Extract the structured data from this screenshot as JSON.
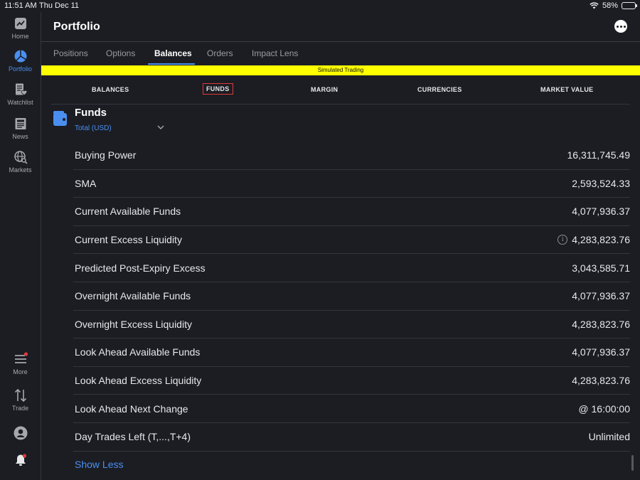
{
  "status_bar": {
    "time": "11:51 AM",
    "date": "Thu Dec 11",
    "battery": "58%"
  },
  "rail": {
    "home": "Home",
    "portfolio": "Portfolio",
    "watchlist": "Watchlist",
    "news": "News",
    "markets": "Markets",
    "more": "More",
    "trade": "Trade"
  },
  "header": {
    "title": "Portfolio"
  },
  "tabs": [
    "Positions",
    "Options",
    "Balances",
    "Orders",
    "Impact Lens"
  ],
  "banner": "Simulated Trading",
  "subtabs": [
    "BALANCES",
    "FUNDS",
    "MARGIN",
    "CURRENCIES",
    "MARKET VALUE"
  ],
  "funds": {
    "title": "Funds",
    "selector": "Total (USD)"
  },
  "rows": [
    {
      "label": "Buying Power",
      "value": "16,311,745.49"
    },
    {
      "label": "SMA",
      "value": "2,593,524.33"
    },
    {
      "label": "Current Available Funds",
      "value": "4,077,936.37"
    },
    {
      "label": "Current Excess Liquidity",
      "value": "4,283,823.76"
    },
    {
      "label": "Predicted Post-Expiry Excess",
      "value": "3,043,585.71"
    },
    {
      "label": "Overnight Available Funds",
      "value": "4,077,936.37"
    },
    {
      "label": "Overnight Excess Liquidity",
      "value": "4,283,823.76"
    },
    {
      "label": "Look Ahead Available Funds",
      "value": "4,077,936.37"
    },
    {
      "label": "Look Ahead Excess Liquidity",
      "value": "4,283,823.76"
    },
    {
      "label": "Look Ahead Next Change",
      "value": "@ 16:00:00"
    },
    {
      "label": "Day Trades Left (T,...,T+4)",
      "value": "Unlimited"
    }
  ],
  "show_less": "Show Less",
  "colors": {
    "accent": "#4a8ff0",
    "banner": "#ffff00",
    "background": "#1b1d23",
    "selected_outline": "#e03a3a",
    "notification_dot": "#e03a3a"
  }
}
